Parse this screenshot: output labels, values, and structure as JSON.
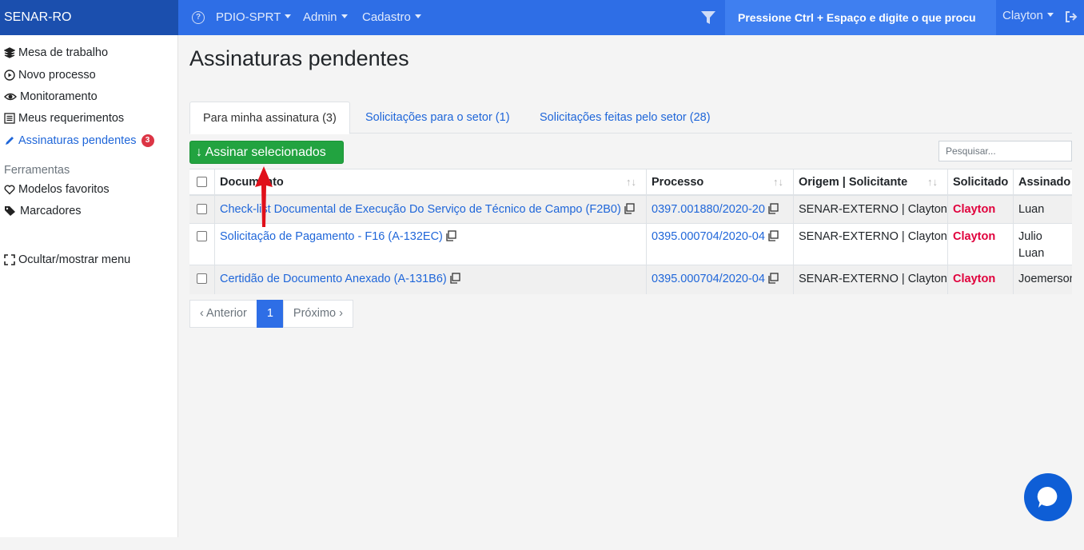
{
  "brand": "SENAR-RO",
  "topbar": {
    "help_icon": "question-circle-icon",
    "menus": [
      "PDIO-SPRT",
      "Admin",
      "Cadastro"
    ],
    "search_label": "Pressione Ctrl + Espaço e digite o que procu",
    "user": "Clayton",
    "filter_icon": "filter-icon",
    "logout_icon": "sign-out-icon"
  },
  "sidebar": {
    "items": [
      {
        "label": "Mesa de trabalho",
        "icon": "layers-icon"
      },
      {
        "label": "Novo processo",
        "icon": "play-circle-icon"
      },
      {
        "label": "Monitoramento",
        "icon": "eye-icon"
      },
      {
        "label": "Meus requerimentos",
        "icon": "list-alt-icon"
      },
      {
        "label": "Assinaturas pendentes",
        "icon": "pen-icon",
        "badge": "3",
        "active": true
      }
    ],
    "section": "Ferramentas",
    "tools": [
      {
        "label": "Modelos favoritos",
        "icon": "heart-icon"
      },
      {
        "label": "Marcadores",
        "icon": "tags-icon"
      }
    ],
    "toggle": {
      "label": "Ocultar/mostrar menu",
      "icon": "expand-icon"
    }
  },
  "main": {
    "title": "Assinaturas pendentes",
    "tabs": [
      {
        "label": "Para minha assinatura (3)",
        "active": true
      },
      {
        "label": "Solicitações para o setor (1)"
      },
      {
        "label": "Solicitações feitas pelo setor (28)"
      }
    ],
    "sign_button": "↓ Assinar selecionados",
    "search_placeholder": "Pesquisar...",
    "table": {
      "headers": [
        "Documento",
        "Processo",
        "Origem | Solicitante",
        "Solicitado",
        "Assinado"
      ],
      "sort_glyph": "↑↓",
      "rows": [
        {
          "documento": "Check-list Documental de Execução Do Serviço de Técnico de Campo (F2B0)",
          "processo": "0397.001880/2020-20",
          "origem": "SENAR-EXTERNO | Clayton",
          "solicitado": "Clayton",
          "assinado": [
            "Luan"
          ]
        },
        {
          "documento": "Solicitação de Pagamento - F16 (A-132EC)",
          "processo": "0395.000704/2020-04",
          "origem": "SENAR-EXTERNO | Clayton",
          "solicitado": "Clayton",
          "assinado": [
            "Julio",
            "Luan"
          ]
        },
        {
          "documento": "Certidão de Documento Anexado (A-131B6)",
          "processo": "0395.000704/2020-04",
          "origem": "SENAR-EXTERNO | Clayton",
          "solicitado": "Clayton",
          "assinado": [
            "Joemerson"
          ]
        }
      ]
    },
    "pagination": {
      "prev": "‹ Anterior",
      "current": "1",
      "next": "Próximo ›"
    }
  },
  "colors": {
    "topbar": "#2e6ee6",
    "brand": "#1b4fae",
    "link": "#1f66d9",
    "sign_button": "#22a340",
    "solicitado": "#e0003c",
    "arrow": "#e0101a",
    "chat": "#0e5ed6"
  },
  "chat_icon": "chat-bubble-icon"
}
